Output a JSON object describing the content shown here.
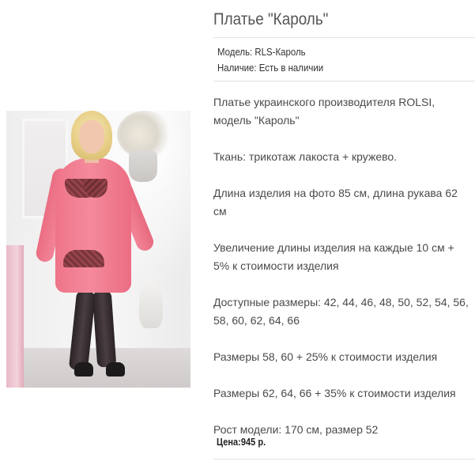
{
  "product": {
    "title": "Платье \"Кароль\"",
    "image_alt": "model-in-pink-dress-photo"
  },
  "meta": {
    "model_line": "Модель: RLS-Кароль",
    "availability_line": "Наличие: Есть в наличии"
  },
  "description": {
    "paragraphs": [
      "Платье украинского производителя ROLSI,\nмодель \"Кароль\"",
      "Ткань: трикотаж лакоста + кружево.",
      "Длина изделия на фото 85 см, длина рукава 62\nсм",
      "Увеличение длины изделия на каждые 10 см +\n 5% к стоимости изделия",
      "Доступные размеры: 42, 44, 46, 48, 50, 52, 54, 56,\n58, 60, 62, 64, 66",
      "Размеры 58, 60 +  25% к стоимости изделия",
      "Размеры 62, 64, 66 + 35% к стоимости изделия",
      "Рост модели: 170 см, размер 52"
    ]
  },
  "price": {
    "line": "Цена:945 р."
  },
  "colors": {
    "dress_pink": "#f07d92",
    "lace_dark": "#6a2d31",
    "text": "#4a4a4a",
    "rule": "#e3e3e3"
  }
}
